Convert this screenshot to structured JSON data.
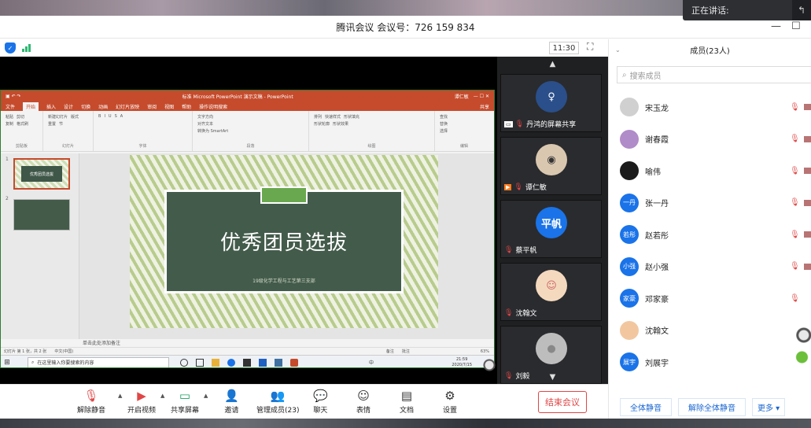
{
  "speaking": {
    "label": "正在讲话:"
  },
  "window": {
    "title": "腾讯会议 会议号：726 159 834",
    "minimize": "—",
    "maximize": "☐"
  },
  "status": {
    "time": "11:30"
  },
  "ppt": {
    "title": "标准 Microsoft PowerPoint 演示文稿 - PowerPoint",
    "user": "谭仁敏",
    "share": "共享",
    "menu": [
      "文件",
      "开始",
      "插入",
      "设计",
      "切换",
      "动画",
      "幻灯片放映",
      "审阅",
      "视图",
      "帮助",
      "操作说明搜索"
    ],
    "active_menu": "开始",
    "ribbon_groups": [
      {
        "name": "剪贴板",
        "items": [
          "粘贴",
          "剪切",
          "复制",
          "格式刷"
        ]
      },
      {
        "name": "幻灯片",
        "items": [
          "新建幻灯片",
          "版式",
          "重置",
          "节"
        ]
      },
      {
        "name": "字体",
        "items": [
          "B",
          "I",
          "U",
          "S",
          "A"
        ]
      },
      {
        "name": "段落",
        "items": [
          "文字方向",
          "对齐文本",
          "转换为 SmartArt"
        ]
      },
      {
        "name": "绘图",
        "items": [
          "排列",
          "快速样式",
          "形状填充",
          "形状轮廓",
          "形状效果"
        ]
      },
      {
        "name": "编辑",
        "items": [
          "查找",
          "替换",
          "选择"
        ]
      }
    ],
    "thumb1_text": "优秀团员选拔",
    "slide_title": "优秀团员选拔",
    "slide_subtitle": "19级化学工程与工艺第三支部",
    "notes": "单击此处添加备注",
    "status_left": "幻灯片 第 1 张，共 2 张",
    "status_lang": "中文(中国)",
    "status_notes": "备注",
    "status_comments": "批注",
    "zoom": "63%",
    "taskbar_search": "在这里输入你要搜索的内容",
    "clock_time": "21:59",
    "clock_date": "2020/7/15",
    "ime": "中"
  },
  "videos": [
    {
      "name": "丹鸿的屏幕共享",
      "badge": "screen"
    },
    {
      "name": "谭仁敏",
      "badge": "camera"
    },
    {
      "name": "蔡平帆",
      "avatar_text": "平帆",
      "avatar_color": "#1a73e8"
    },
    {
      "name": "沈翰文"
    },
    {
      "name": "刘毅"
    }
  ],
  "toolbar": {
    "mute": "解除静音",
    "video": "开启视频",
    "share": "共享屏幕",
    "invite": "邀请",
    "members": "管理成员(23)",
    "chat": "聊天",
    "emoji": "表情",
    "docs": "文档",
    "settings": "设置",
    "end": "结束会议"
  },
  "members_panel": {
    "title": "成员(23人)",
    "search_placeholder": "搜索成员",
    "list": [
      {
        "name": "宋玉龙",
        "avatar_text": "",
        "color": "#d0d0d0"
      },
      {
        "name": "谢春霞",
        "avatar_text": "",
        "color": "#b08cc8"
      },
      {
        "name": "喻伟",
        "avatar_text": "",
        "color": "#1b1b1b"
      },
      {
        "name": "张一丹",
        "avatar_text": "一丹",
        "color": "#1a73e8"
      },
      {
        "name": "赵若彤",
        "avatar_text": "若彤",
        "color": "#1a73e8"
      },
      {
        "name": "赵小强",
        "avatar_text": "小强",
        "color": "#1a73e8"
      },
      {
        "name": "邓家豪",
        "avatar_text": "家豪",
        "color": "#1a73e8"
      },
      {
        "name": "沈翰文",
        "avatar_text": "",
        "color": "#f2c7a0"
      },
      {
        "name": "刘展宇",
        "avatar_text": "展宇",
        "color": "#1a73e8"
      }
    ],
    "mute_all": "全体静音",
    "unmute_all": "解除全体静音",
    "more": "更多 ▾"
  }
}
